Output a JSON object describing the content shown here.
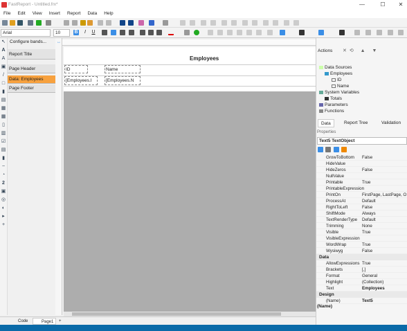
{
  "window": {
    "title": "FastReport - Untitled.frx*",
    "minimize": "—",
    "maximize": "☐",
    "close": "✕"
  },
  "menu": [
    "File",
    "Edit",
    "View",
    "Insert",
    "Report",
    "Data",
    "Help"
  ],
  "toolbar": {
    "font": "Arial",
    "size": "10"
  },
  "bands": {
    "configure": "Configure bands...",
    "items": [
      "Report Title",
      "Page Header",
      "Data: Employees",
      "Page Footer"
    ]
  },
  "designer": {
    "header_text": "Employees",
    "cols": [
      {
        "title": "ID",
        "data": "[Employees.I"
      },
      {
        "title": "Name",
        "data": "[Employees.N"
      }
    ]
  },
  "bottom_tabs": {
    "code": "Code",
    "page": "Page1",
    "add": "+"
  },
  "right": {
    "actions": "Actions",
    "tree": {
      "data_sources": "Data Sources",
      "employees": "Employees",
      "id": "ID",
      "name": "Name",
      "system_variables": "System Variables",
      "totals": "Totals",
      "parameters": "Parameters",
      "functions": "Functions"
    },
    "tabs": [
      "Data",
      "Report Tree",
      "Validation"
    ],
    "properties_title": "Properties",
    "selected": "Text5  TextObject",
    "props": [
      [
        "GrowToBottom",
        "False"
      ],
      [
        "HideValue",
        ""
      ],
      [
        "HideZeros",
        "False"
      ],
      [
        "NullValue",
        ""
      ],
      [
        "Printable",
        "True"
      ],
      [
        "PrintableExpression",
        ""
      ],
      [
        "PrintOn",
        "FirstPage, LastPage, O"
      ],
      [
        "ProcessAt",
        "Default"
      ],
      [
        "RightToLeft",
        "False"
      ],
      [
        "ShiftMode",
        "Always"
      ],
      [
        "TextRenderType",
        "Default"
      ],
      [
        "Trimming",
        "None"
      ],
      [
        "Visible",
        "True"
      ],
      [
        "VisibleExpression",
        ""
      ],
      [
        "WordWrap",
        "True"
      ],
      [
        "Wysiwyg",
        "False"
      ]
    ],
    "cat_data": "Data",
    "data_props": [
      [
        "AllowExpressions",
        "True"
      ],
      [
        "Brackets",
        "[,]"
      ],
      [
        "Format",
        "General"
      ],
      [
        "Highlight",
        "(Collection)"
      ],
      [
        "Text",
        "Employees"
      ]
    ],
    "cat_design": "Design",
    "design_props": [
      [
        "(Name)",
        "Text5"
      ]
    ],
    "footer": "(Name)"
  }
}
